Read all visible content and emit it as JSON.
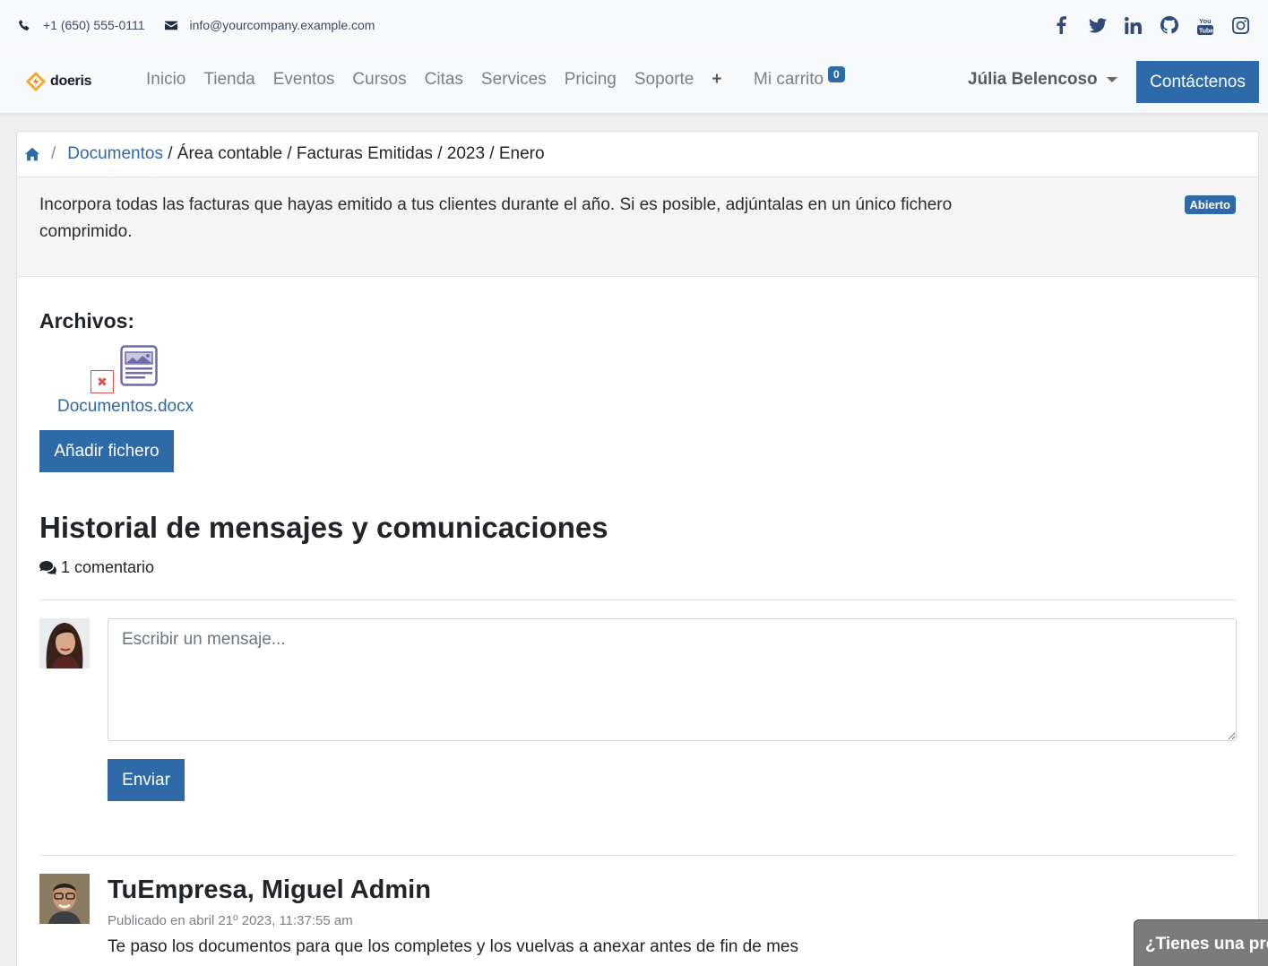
{
  "topbar": {
    "phone": "+1 (650) 555-0111",
    "email": "info@yourcompany.example.com",
    "social_icons": [
      "facebook-icon",
      "twitter-icon",
      "linkedin-icon",
      "github-icon",
      "youtube-icon",
      "instagram-icon"
    ]
  },
  "navbar": {
    "brand": "doeris",
    "menu": [
      "Inicio",
      "Tienda",
      "Eventos",
      "Cursos",
      "Citas",
      "Services",
      "Pricing",
      "Soporte"
    ],
    "plus": "+",
    "cart_label": "Mi carrito",
    "cart_count": "0",
    "user_name": "Júlia Belencoso",
    "contact_button": "Contáctenos"
  },
  "breadcrumb": {
    "sep": "/",
    "link": "Documentos",
    "rest": " / Área contable / Facturas Emitidas / 2023 / Enero"
  },
  "request": {
    "description": "Incorpora todas las facturas que hayas emitido a tus clientes durante el año. Si es posible, adjúntalas en un único fichero comprimido.",
    "status": "Abierto"
  },
  "files": {
    "title": "Archivos:",
    "items": [
      {
        "name": "Documentos.docx"
      }
    ],
    "delete_symbol": "✖",
    "add_button": "Añadir fichero"
  },
  "history": {
    "title": "Historial de mensajes y comunicaciones",
    "count": "1 comentario",
    "input_placeholder": "Escribir un mensaje...",
    "send_button": "Enviar",
    "messages": [
      {
        "author": "TuEmpresa, Miguel Admin",
        "posted": "Publicado en abril 21º 2023, 11:37:55 am",
        "body": "Te paso los documentos para que los completes y los vuelvas a anexar antes de fin de mes"
      }
    ]
  },
  "chat": {
    "label": "¿Tienes una pregunta?"
  },
  "colors": {
    "primary": "#2e6aa8",
    "danger": "#d9534f",
    "panel": "#f5f5f5"
  }
}
